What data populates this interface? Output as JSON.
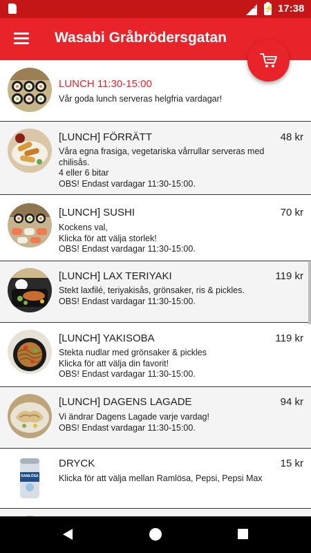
{
  "status_bar": {
    "network": "LTE",
    "time": "17:38"
  },
  "app_bar": {
    "title": "Wasabi Gråbrödersgatan",
    "menu_icon": "hamburger-menu-icon",
    "cart_icon": "shopping-cart-icon"
  },
  "colors": {
    "primary": "#e8232a",
    "status_bar": "#c41517",
    "lunch_heading": "#e8232a"
  },
  "menu_header": {
    "title": "LUNCH 11:30-15:00",
    "description": "Vår goda lunch serveras helgfria vardagar!"
  },
  "items": [
    {
      "title": "[LUNCH] FÖRRÄTT",
      "price": "48 kr",
      "description": "Våra egna frasiga, vegetariska vårrullar serveras med chilisås.\n4 eller 6 bitar\nOBS! Endast vardagar 11:30-15:00."
    },
    {
      "title": "[LUNCH] SUSHI",
      "price": "70 kr",
      "description": "Kockens val,\nKlicka för att välja storlek!\nOBS! Endast vardagar 11:30-15:00."
    },
    {
      "title": "[LUNCH] LAX TERIYAKI",
      "price": "119 kr",
      "description": "Stekt laxfilé, teriyakisås, grönsaker, ris & pickles.\nOBS! Endast vardagar 11:30-15:00."
    },
    {
      "title": "[LUNCH] YAKISOBA",
      "price": "119 kr",
      "description": "Stekta nudlar med grönsaker & pickles\nKlicka för att välja din favorit!\nOBS! Endast vardagar 11:30-15:00."
    },
    {
      "title": "[LUNCH] DAGENS LAGADE",
      "price": "94 kr",
      "description": "Vi ändrar Dagens Lagade varje vardag!\nOBS! Endast vardagar 11:30-15:00."
    },
    {
      "title": "DRYCK",
      "price": "15 kr",
      "description": "Klicka för att välja mellan Ramlösa, Pepsi, Pepsi Max"
    }
  ],
  "drink_can_label": "RAMLÖSA",
  "nav_bar": {
    "back_icon": "back-triangle-icon",
    "home_icon": "home-circle-icon",
    "recents_icon": "recents-square-icon"
  }
}
